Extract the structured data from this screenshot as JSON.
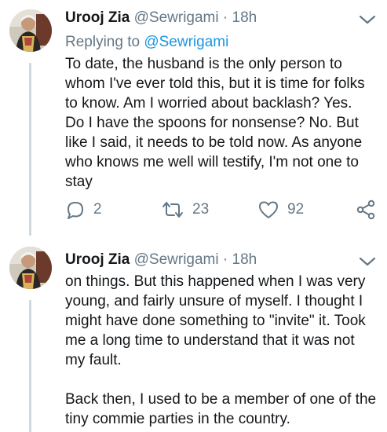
{
  "tweets": [
    {
      "author": {
        "name": "Urooj Zia",
        "handle": "@Sewrigami",
        "separator": "·",
        "time": "18h",
        "avatar": "avatar-photo"
      },
      "reply": {
        "prefix": "Replying to ",
        "handle": "@Sewrigami"
      },
      "text": "To date, the husband is the only person to\nwhom I've ever told this, but it is time for folks\nto know. Am I worried about backlash? Yes.\nDo I have the spoons for nonsense? No. But\nlike I said, it needs to be told now. As anyone\nwho knows me well will testify, I'm not one to\nstay",
      "actions": {
        "replies": "2",
        "retweets": "23",
        "likes": "92",
        "reply_icon": "reply-icon",
        "retweet_icon": "retweet-icon",
        "like_icon": "heart-icon",
        "share_icon": "share-icon"
      }
    },
    {
      "author": {
        "name": "Urooj Zia",
        "handle": "@Sewrigami",
        "separator": "·",
        "time": "18h",
        "avatar": "avatar-photo"
      },
      "text": "on things. But this happened when I was very\nyoung, and fairly unsure of myself. I thought I\nmight have done something to \"invite\" it. Took\nme a long time to understand that it was not\nmy fault.\n\nBack then, I used to be a member of one of the\ntiny commie parties in the country."
    }
  ],
  "colors": {
    "text": "#14171a",
    "secondary": "#657786",
    "link": "#1b95e0",
    "thread_line": "#cfd9de"
  }
}
